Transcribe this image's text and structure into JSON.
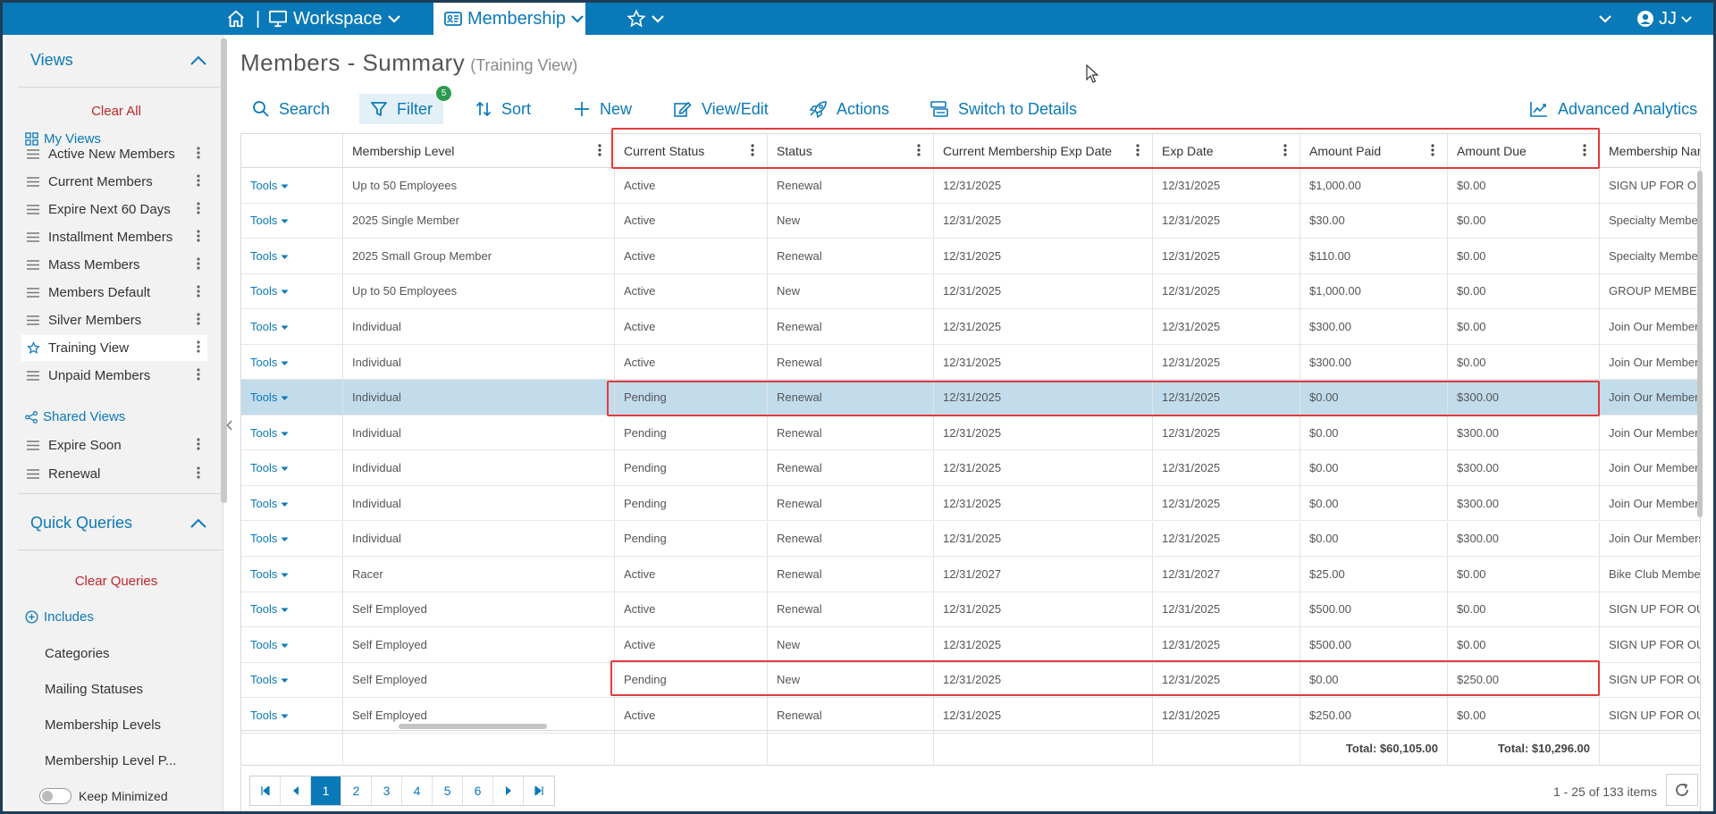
{
  "topbar": {
    "sep": "|",
    "workspace": "Workspace",
    "membership": "Membership",
    "user_initials": "JJ"
  },
  "sidebar": {
    "views_title": "Views",
    "clear_all": "Clear All",
    "my_views": "My Views",
    "items": [
      {
        "label": "Active New Members"
      },
      {
        "label": "Current Members"
      },
      {
        "label": "Expire Next 60 Days"
      },
      {
        "label": "Installment Members"
      },
      {
        "label": "Mass Members"
      },
      {
        "label": "Members Default"
      },
      {
        "label": "Silver Members"
      },
      {
        "label": "Training View"
      },
      {
        "label": "Unpaid Members"
      }
    ],
    "shared_views": "Shared Views",
    "shared_items": [
      {
        "label": "Expire Soon"
      },
      {
        "label": "Renewal"
      }
    ],
    "quick_queries_title": "Quick Queries",
    "clear_queries": "Clear Queries",
    "includes": "Includes",
    "queries": [
      "Categories",
      "Mailing Statuses",
      "Membership Levels",
      "Membership Level P..."
    ],
    "keep_minimized": "Keep Minimized"
  },
  "page": {
    "title": "Members - Summary",
    "subtitle": "(Training View)"
  },
  "toolbar": {
    "search": "Search",
    "filter": "Filter",
    "filter_count": "5",
    "sort": "Sort",
    "new": "New",
    "view_edit": "View/Edit",
    "actions": "Actions",
    "switch": "Switch to Details",
    "analytics": "Advanced Analytics"
  },
  "grid": {
    "tools_label": "Tools",
    "headers": [
      "Membership Level",
      "Current Status",
      "Status",
      "Current Membership Exp Date",
      "Exp Date",
      "Amount Paid",
      "Amount Due",
      "Membership Nam"
    ],
    "rows": [
      [
        "Up to 50 Employees",
        "Active",
        "Renewal",
        "12/31/2025",
        "12/31/2025",
        "$1,000.00",
        "$0.00",
        "SIGN UP FOR OUR"
      ],
      [
        "2025 Single Member",
        "Active",
        "New",
        "12/31/2025",
        "12/31/2025",
        "$30.00",
        "$0.00",
        "Specialty Members"
      ],
      [
        "2025 Small Group Member",
        "Active",
        "Renewal",
        "12/31/2025",
        "12/31/2025",
        "$110.00",
        "$0.00",
        "Specialty Members"
      ],
      [
        "Up to 50 Employees",
        "Active",
        "New",
        "12/31/2025",
        "12/31/2025",
        "$1,000.00",
        "$0.00",
        "GROUP MEMBERS"
      ],
      [
        "Individual",
        "Active",
        "Renewal",
        "12/31/2025",
        "12/31/2025",
        "$300.00",
        "$0.00",
        "Join Our Members"
      ],
      [
        "Individual",
        "Active",
        "Renewal",
        "12/31/2025",
        "12/31/2025",
        "$300.00",
        "$0.00",
        "Join Our Members"
      ],
      [
        "Individual",
        "Pending",
        "Renewal",
        "12/31/2025",
        "12/31/2025",
        "$0.00",
        "$300.00",
        "Join Our Members"
      ],
      [
        "Individual",
        "Pending",
        "Renewal",
        "12/31/2025",
        "12/31/2025",
        "$0.00",
        "$300.00",
        "Join Our Members"
      ],
      [
        "Individual",
        "Pending",
        "Renewal",
        "12/31/2025",
        "12/31/2025",
        "$0.00",
        "$300.00",
        "Join Our Members"
      ],
      [
        "Individual",
        "Pending",
        "Renewal",
        "12/31/2025",
        "12/31/2025",
        "$0.00",
        "$300.00",
        "Join Our Members"
      ],
      [
        "Individual",
        "Pending",
        "Renewal",
        "12/31/2025",
        "12/31/2025",
        "$0.00",
        "$300.00",
        "Join Our Members"
      ],
      [
        "Racer",
        "Active",
        "Renewal",
        "12/31/2027",
        "12/31/2027",
        "$25.00",
        "$0.00",
        "Bike Club Member"
      ],
      [
        "Self Employed",
        "Active",
        "Renewal",
        "12/31/2025",
        "12/31/2025",
        "$500.00",
        "$0.00",
        "SIGN UP FOR OUR"
      ],
      [
        "Self Employed",
        "Active",
        "New",
        "12/31/2025",
        "12/31/2025",
        "$500.00",
        "$0.00",
        "SIGN UP FOR OUR"
      ],
      [
        "Self Employed",
        "Pending",
        "New",
        "12/31/2025",
        "12/31/2025",
        "$0.00",
        "$250.00",
        "SIGN UP FOR OUR"
      ],
      [
        "Self Employed",
        "Active",
        "Renewal",
        "12/31/2025",
        "12/31/2025",
        "$250.00",
        "$0.00",
        "SIGN UP FOR OUR"
      ]
    ],
    "total_paid": "Total: $60,105.00",
    "total_due": "Total: $10,296.00"
  },
  "pager": {
    "pages": [
      "1",
      "2",
      "3",
      "4",
      "5",
      "6"
    ],
    "current": "1",
    "info": "1 - 25 of 133 items"
  },
  "colors": {
    "brand": "#0a79b8",
    "highlight": "#e23b3b",
    "selected_row": "#c2dcec",
    "clear": "#c0262d"
  }
}
